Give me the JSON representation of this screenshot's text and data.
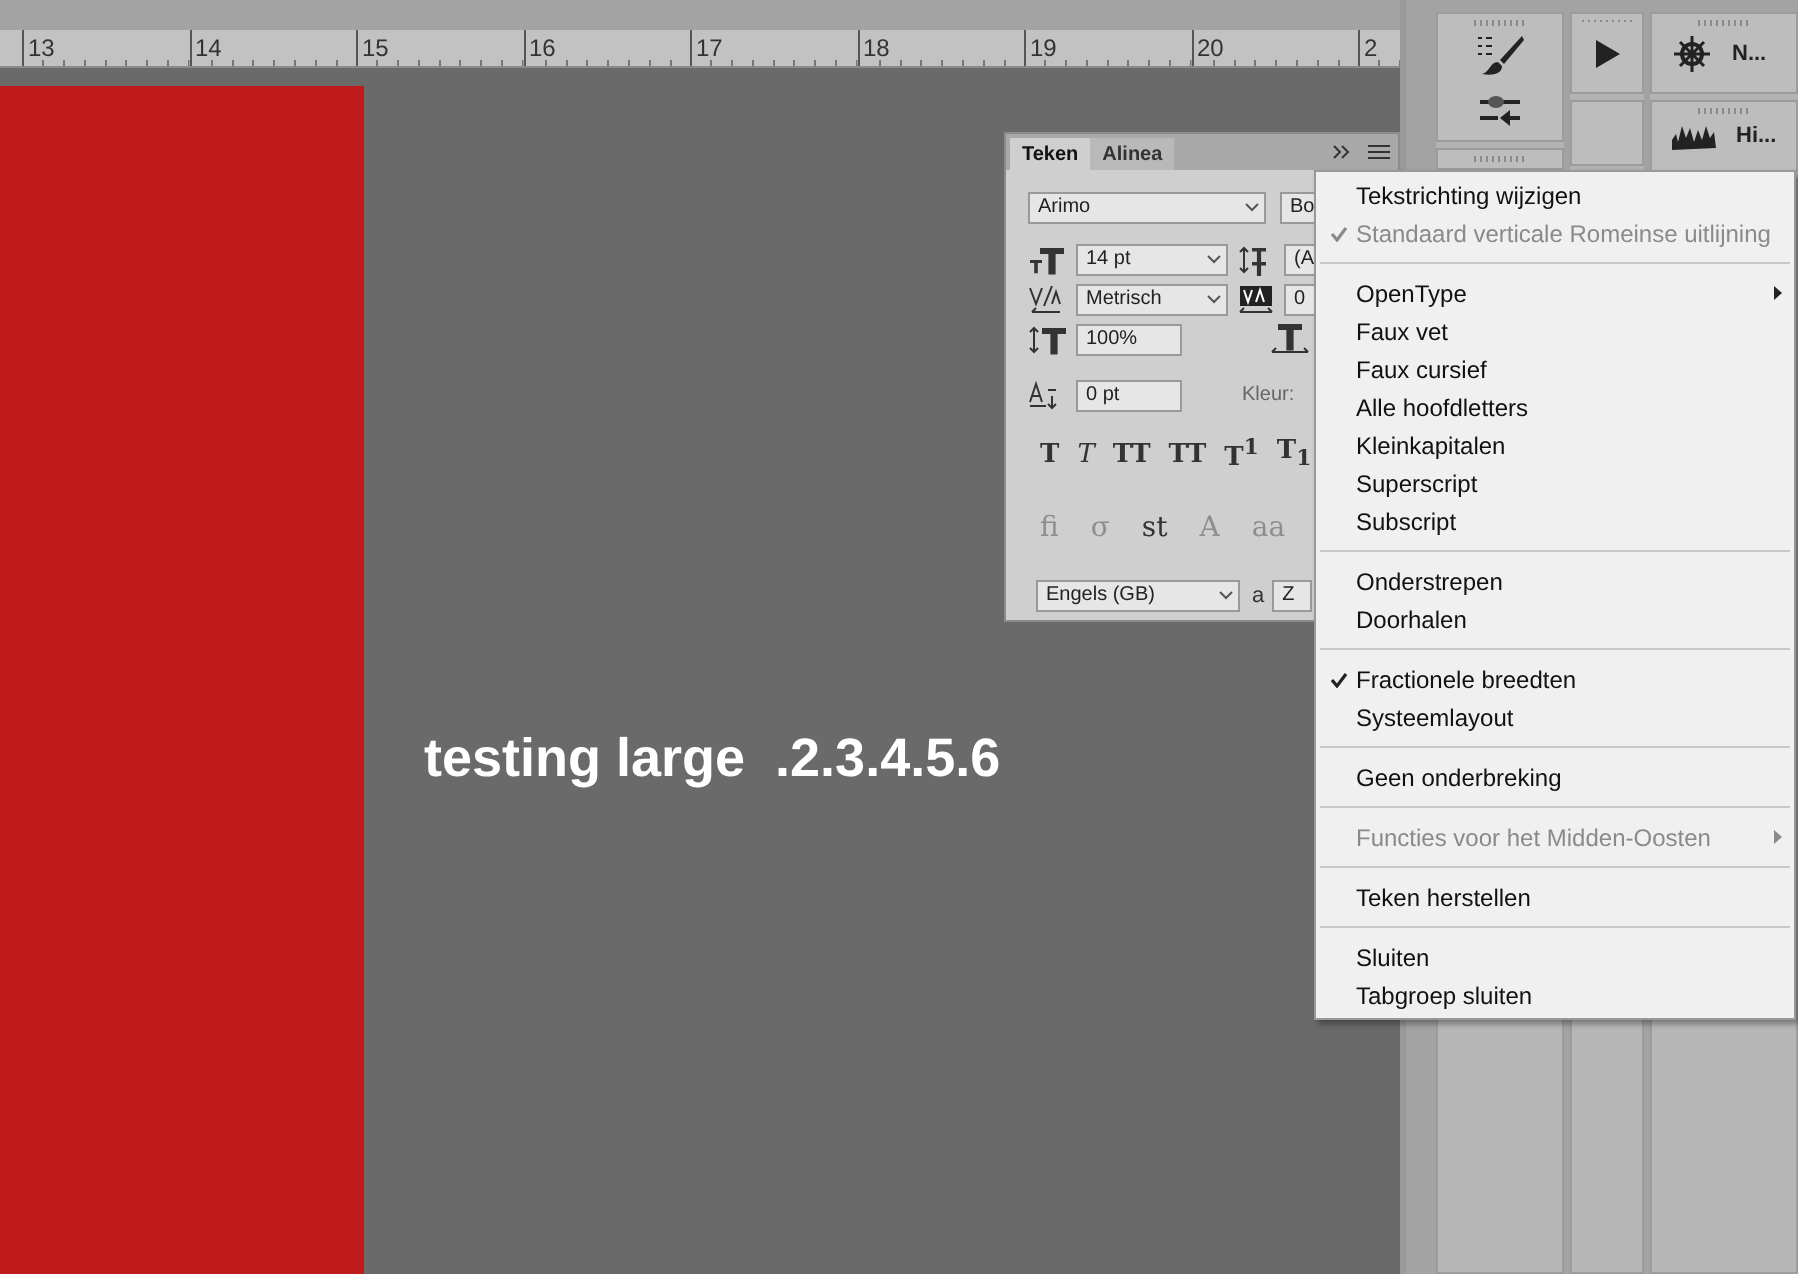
{
  "ruler": {
    "labels": [
      "13",
      "14",
      "15",
      "16",
      "17",
      "18",
      "19",
      "20",
      "2"
    ]
  },
  "canvas": {
    "text": "testing large  .2.3.4.5.6"
  },
  "character_panel": {
    "tabs": [
      {
        "label": "Teken",
        "selected": true
      },
      {
        "label": "Alinea",
        "selected": false
      }
    ],
    "font_family": "Arimo",
    "font_style": "Bo",
    "font_size": "14 pt",
    "leading": "(A",
    "kerning": "Metrisch",
    "tracking": "0",
    "vertical_scale": "100%",
    "baseline_shift": "0 pt",
    "color_label": "Kleur:",
    "style_buttons": [
      {
        "label": "T",
        "kind": "bold"
      },
      {
        "label": "T",
        "kind": "italic"
      },
      {
        "label": "TT",
        "kind": "caps"
      },
      {
        "label": "TT",
        "kind": "smallcaps"
      },
      {
        "label": "T$^{1}$",
        "kind": "super"
      },
      {
        "label": "T$_{1}$",
        "kind": "sub"
      }
    ],
    "opentype_buttons": [
      {
        "label": "fi",
        "disabled": true
      },
      {
        "label": "σ",
        "disabled": true
      },
      {
        "label": "st",
        "disabled": false
      },
      {
        "label": "A",
        "disabled": true
      },
      {
        "label": "aa",
        "disabled": true
      }
    ],
    "language": "Engels (GB)",
    "antialias_label": "a",
    "antialias_value": "Z"
  },
  "context_menu": {
    "groups": [
      [
        {
          "label": "Tekstrichting wijzigen",
          "checked": false,
          "disabled": false,
          "submenu": false
        },
        {
          "label": "Standaard verticale Romeinse uitlijning",
          "checked": true,
          "disabled": true,
          "submenu": false
        }
      ],
      [
        {
          "label": "OpenType",
          "checked": false,
          "disabled": false,
          "submenu": true
        },
        {
          "label": "Faux vet",
          "checked": false,
          "disabled": false,
          "submenu": false
        },
        {
          "label": "Faux cursief",
          "checked": false,
          "disabled": false,
          "submenu": false
        },
        {
          "label": "Alle hoofdletters",
          "checked": false,
          "disabled": false,
          "submenu": false
        },
        {
          "label": "Kleinkapitalen",
          "checked": false,
          "disabled": false,
          "submenu": false
        },
        {
          "label": "Superscript",
          "checked": false,
          "disabled": false,
          "submenu": false
        },
        {
          "label": "Subscript",
          "checked": false,
          "disabled": false,
          "submenu": false
        }
      ],
      [
        {
          "label": "Onderstrepen",
          "checked": false,
          "disabled": false,
          "submenu": false
        },
        {
          "label": "Doorhalen",
          "checked": false,
          "disabled": false,
          "submenu": false
        }
      ],
      [
        {
          "label": "Fractionele breedten",
          "checked": true,
          "disabled": false,
          "submenu": false
        },
        {
          "label": "Systeemlayout",
          "checked": false,
          "disabled": false,
          "submenu": false
        }
      ],
      [
        {
          "label": "Geen onderbreking",
          "checked": false,
          "disabled": false,
          "submenu": false
        }
      ],
      [
        {
          "label": "Functies voor het Midden-Oosten",
          "checked": false,
          "disabled": true,
          "submenu": true
        }
      ],
      [
        {
          "label": "Teken herstellen",
          "checked": false,
          "disabled": false,
          "submenu": false
        }
      ],
      [
        {
          "label": "Sluiten",
          "checked": false,
          "disabled": false,
          "submenu": false
        },
        {
          "label": "Tabgroep sluiten",
          "checked": false,
          "disabled": false,
          "submenu": false
        }
      ]
    ]
  },
  "dock": {
    "panels": [
      {
        "label": "N..."
      },
      {
        "label": "Hi..."
      }
    ]
  }
}
